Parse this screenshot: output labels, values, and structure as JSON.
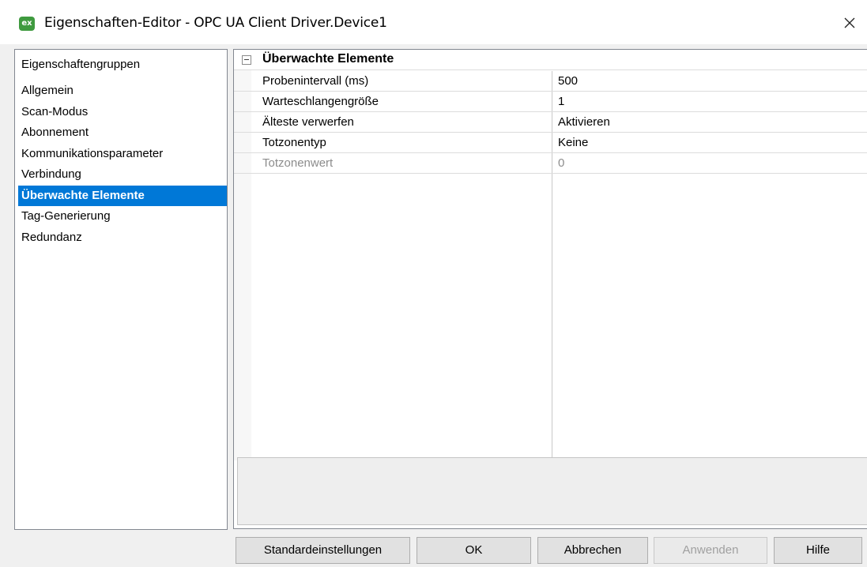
{
  "window": {
    "title": "Eigenschaften-Editor - OPC UA Client Driver.Device1",
    "app_icon_text": "ex",
    "close_glyph": "close-icon"
  },
  "groups": {
    "header": "Eigenschaftengruppen",
    "items": [
      {
        "label": "Allgemein"
      },
      {
        "label": "Scan-Modus"
      },
      {
        "label": "Abonnement"
      },
      {
        "label": "Kommunikationsparameter"
      },
      {
        "label": "Verbindung"
      },
      {
        "label": "Überwachte Elemente",
        "selected": true
      },
      {
        "label": "Tag-Generierung"
      },
      {
        "label": "Redundanz"
      }
    ]
  },
  "properties": {
    "category": "Überwachte Elemente",
    "rows": [
      {
        "name": "Probenintervall (ms)",
        "value": "500"
      },
      {
        "name": "Warteschlangengröße",
        "value": "1"
      },
      {
        "name": "Älteste verwerfen",
        "value": "Aktivieren"
      },
      {
        "name": "Totzonentyp",
        "value": "Keine"
      },
      {
        "name": "Totzonenwert",
        "value": "0",
        "disabled": true
      }
    ]
  },
  "buttons": {
    "defaults": "Standardeinstellungen",
    "ok": "OK",
    "cancel": "Abbrechen",
    "apply": "Anwenden",
    "help": "Hilfe"
  },
  "colors": {
    "selection": "#0078d7",
    "disabled_text": "#8c8c8c"
  }
}
